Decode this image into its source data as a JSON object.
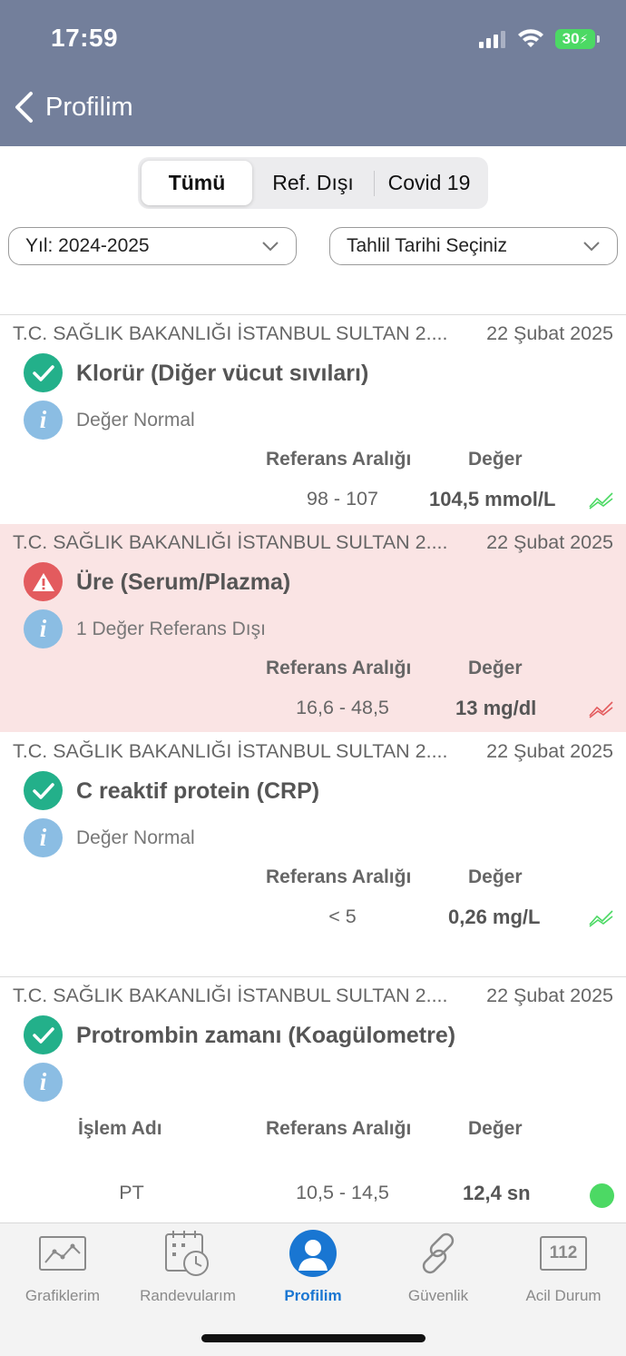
{
  "status_bar": {
    "time": "17:59",
    "battery": "30"
  },
  "header": {
    "back_title": "Profilim"
  },
  "segments": [
    "Tümü",
    "Ref. Dışı",
    "Covid 19"
  ],
  "filters": {
    "year": "Yıl: 2024-2025",
    "date": "Tahlil Tarihi Seçiniz"
  },
  "results": [
    {
      "hospital": "T.C. SAĞLIK BAKANLIĞI İSTANBUL SULTAN 2....",
      "date": "22 Şubat 2025",
      "status": "normal",
      "test": "Klorür (Diğer vücut sıvıları)",
      "note": "Değer Normal",
      "ref_header": "Referans Aralığı",
      "value_header": "Değer",
      "ref": "98 - 107",
      "value": "104,5 mmol/L",
      "trend": "up"
    },
    {
      "hospital": "T.C. SAĞLIK BAKANLIĞI İSTANBUL SULTAN 2....",
      "date": "22 Şubat 2025",
      "status": "out-of-range",
      "test": "Üre (Serum/Plazma)",
      "note": "1 Değer Referans Dışı",
      "ref_header": "Referans Aralığı",
      "value_header": "Değer",
      "ref": "16,6 - 48,5",
      "value": "13 mg/dl",
      "trend": "down"
    },
    {
      "hospital": "T.C. SAĞLIK BAKANLIĞI İSTANBUL SULTAN 2....",
      "date": "22 Şubat 2025",
      "status": "normal",
      "test": "C reaktif protein (CRP)",
      "note": "Değer Normal",
      "ref_header": "Referans Aralığı",
      "value_header": "Değer",
      "ref": "< 5",
      "value": "0,26 mg/L",
      "trend": "up"
    },
    {
      "hospital": "T.C. SAĞLIK BAKANLIĞI İSTANBUL SULTAN 2....",
      "date": "22 Şubat 2025",
      "status": "normal",
      "test": "Protrombin zamanı (Koagülometre)",
      "name_header": "İşlem Adı",
      "ref_header": "Referans Aralığı",
      "value_header": "Değer",
      "name": "PT",
      "ref": "10,5 - 14,5",
      "value": "12,4 sn",
      "indicator": "green"
    }
  ],
  "tabs": [
    {
      "label": "Grafiklerim",
      "icon": "chart-icon",
      "active": false
    },
    {
      "label": "Randevularım",
      "icon": "calendar-clock-icon",
      "active": false
    },
    {
      "label": "Profilim",
      "icon": "profile-icon",
      "active": true
    },
    {
      "label": "Güvenlik",
      "icon": "link-icon",
      "active": false
    },
    {
      "label": "Acil Durum",
      "icon": "emergency-112-icon",
      "active": false
    },
    {
      "icon_text": "112"
    }
  ],
  "colors": {
    "header_bg": "#737f9b",
    "normal_green": "#23b08a",
    "warning_red": "#e35b5e",
    "alert_row_bg": "#fae4e4",
    "info_blue": "#8bbde3",
    "active_tab": "#1976d2"
  }
}
